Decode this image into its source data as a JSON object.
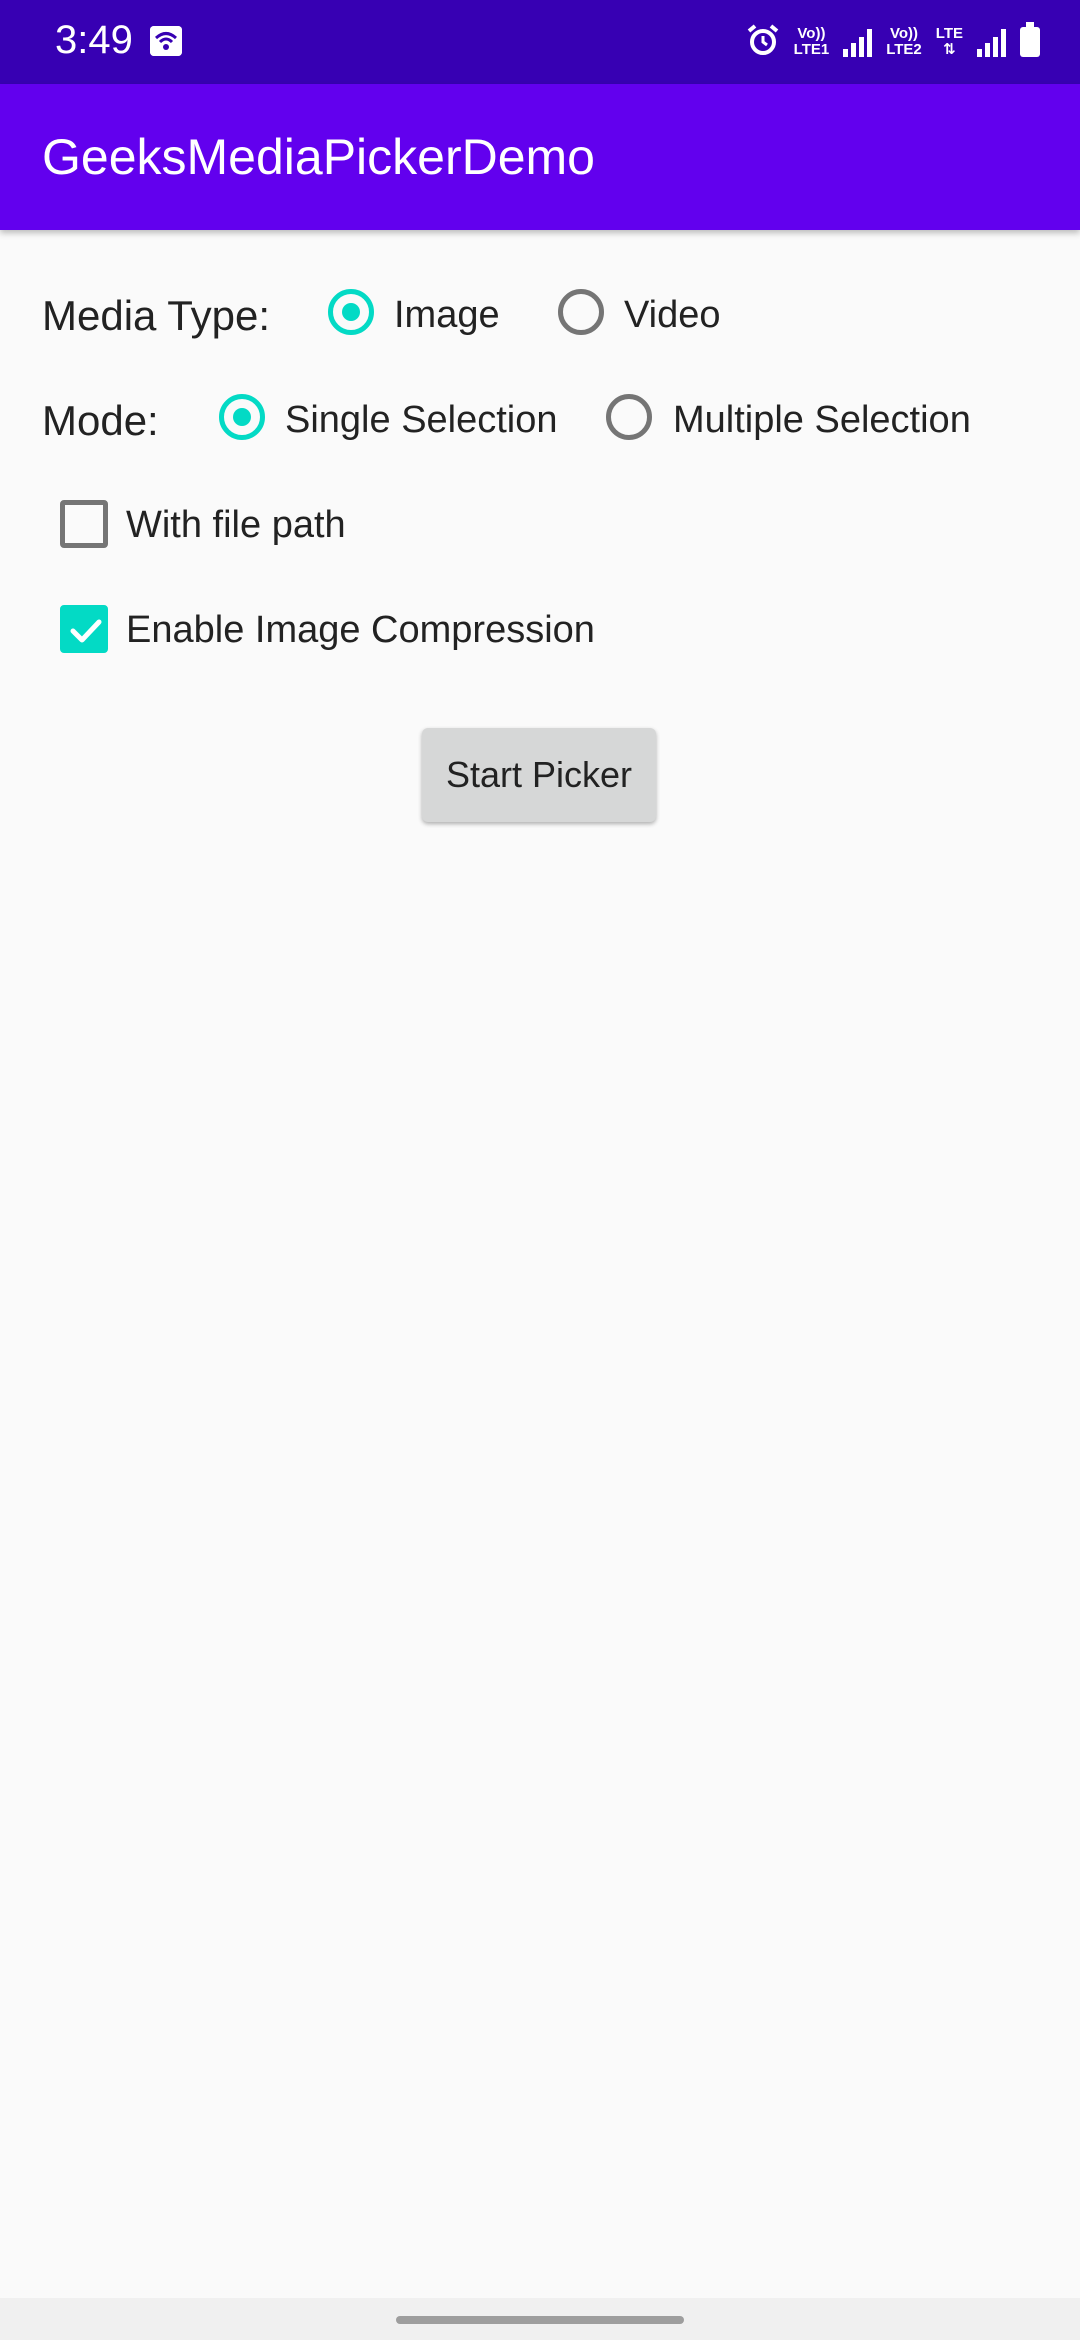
{
  "status_bar": {
    "time": "3:49",
    "sim1_top": "Vo))",
    "sim1_bottom": "LTE1",
    "sim2_top": "Vo))",
    "sim2_bottom": "LTE2",
    "net_type": "LTE",
    "icons": [
      "wifi-icon",
      "alarm-icon",
      "signal-icon",
      "signal-icon",
      "battery-icon"
    ]
  },
  "app_bar": {
    "title": "GeeksMediaPickerDemo"
  },
  "media_type": {
    "label": "Media Type:",
    "options": [
      {
        "label": "Image",
        "checked": true
      },
      {
        "label": "Video",
        "checked": false
      }
    ]
  },
  "mode": {
    "label": "Mode:",
    "options": [
      {
        "label": "Single Selection",
        "checked": true
      },
      {
        "label": "Multiple Selection",
        "checked": false
      }
    ]
  },
  "checkboxes": [
    {
      "label": "With file path",
      "checked": false
    },
    {
      "label": "Enable Image Compression",
      "checked": true
    }
  ],
  "start_button": {
    "label": "Start Picker"
  },
  "colors": {
    "status_bar": "#3700b3",
    "app_bar": "#6200ee",
    "accent": "#03dac5",
    "background": "#fafafa"
  }
}
